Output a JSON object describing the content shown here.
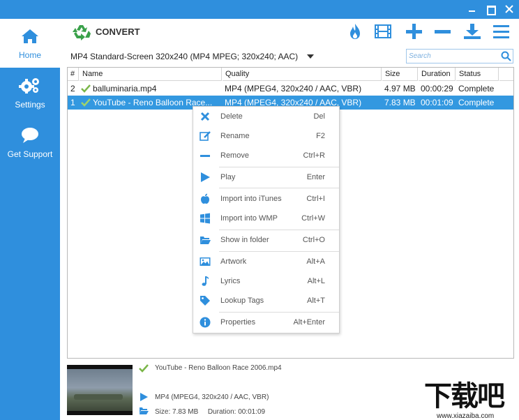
{
  "window": {
    "controls": [
      "minimize",
      "maximize",
      "close"
    ]
  },
  "colors": {
    "accent": "#2f8fdd",
    "selection": "#3398e0",
    "check": "#7ab648",
    "logo_green": "#3aa14a",
    "flame": "#2f8fdd"
  },
  "sidebar": {
    "items": [
      {
        "label": "Home",
        "icon": "home-icon",
        "active": true
      },
      {
        "label": "Settings",
        "icon": "gears-icon",
        "active": false
      },
      {
        "label": "Get Support",
        "icon": "chat-bubble-icon",
        "active": false
      }
    ]
  },
  "toolbar": {
    "title": "CONVERT",
    "icons": [
      "flame-icon",
      "film-strip-icon",
      "plus-icon",
      "minus-icon",
      "download-icon",
      "hamburger-menu-icon"
    ]
  },
  "preset": {
    "value": "MP4 Standard-Screen 320x240 (MP4 MPEG; 320x240; AAC)"
  },
  "search": {
    "placeholder": "Search"
  },
  "table": {
    "columns": [
      "#",
      "Name",
      "Quality",
      "Size",
      "Duration",
      "Status"
    ],
    "rows": [
      {
        "num": "2",
        "name": "balluminaria.mp4",
        "quality": "MP4  (MPEG4, 320x240 / AAC, VBR)",
        "size": "4.97 MB",
        "duration": "00:00:29",
        "status": "Complete",
        "selected": false
      },
      {
        "num": "1",
        "name": "YouTube - Reno Balloon Race...",
        "quality": "MP4  (MPEG4, 320x240 / AAC, VBR)",
        "size": "7.83 MB",
        "duration": "00:01:09",
        "status": "Complete",
        "selected": true
      }
    ]
  },
  "context_menu": {
    "items": [
      {
        "label": "Delete",
        "shortcut": "Del",
        "icon": "x-icon"
      },
      {
        "label": "Rename",
        "shortcut": "F2",
        "icon": "edit-icon"
      },
      {
        "label": "Remove",
        "shortcut": "Ctrl+R",
        "icon": "minus-icon"
      },
      {
        "label": "Play",
        "shortcut": "Enter",
        "icon": "play-icon"
      },
      {
        "label": "Import into iTunes",
        "shortcut": "Ctrl+I",
        "icon": "apple-icon"
      },
      {
        "label": "Import into WMP",
        "shortcut": "Ctrl+W",
        "icon": "windows-icon"
      },
      {
        "label": "Show in folder",
        "shortcut": "Ctrl+O",
        "icon": "folder-open-icon"
      },
      {
        "label": "Artwork",
        "shortcut": "Alt+A",
        "icon": "image-icon"
      },
      {
        "label": "Lyrics",
        "shortcut": "Alt+L",
        "icon": "music-note-icon"
      },
      {
        "label": "Lookup Tags",
        "shortcut": "Alt+T",
        "icon": "tag-icon"
      },
      {
        "label": "Properties",
        "shortcut": "Alt+Enter",
        "icon": "info-icon"
      }
    ]
  },
  "details": {
    "filename": "YouTube - Reno Balloon Race 2006.mp4",
    "format": "MP4  (MPEG4, 320x240 / AAC, VBR)",
    "size_label": "Size:",
    "size": "7.83 MB",
    "duration_label": "Duration:",
    "duration": "00:01:09"
  },
  "watermark": {
    "text": "下载吧",
    "site": "www.xiazaiba.com"
  }
}
